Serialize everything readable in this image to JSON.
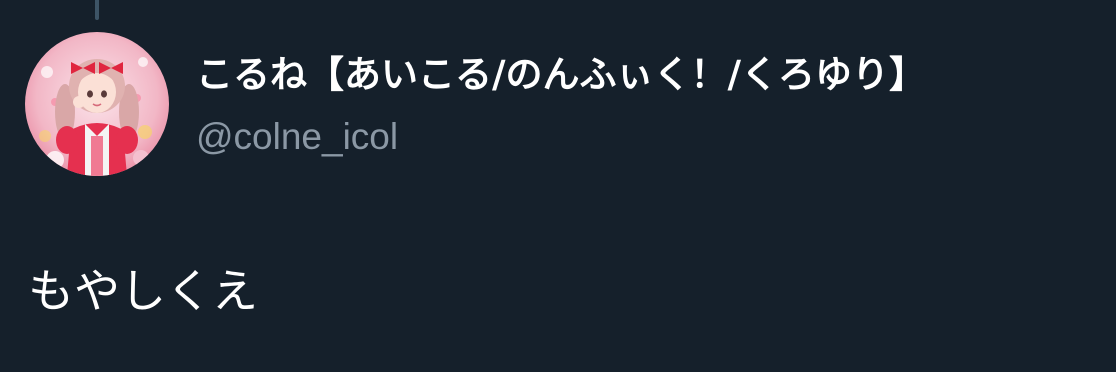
{
  "thread": {
    "connector": "thread-line"
  },
  "author": {
    "avatar_icon": "profile-photo",
    "display_name": "こるね【あいこる/のんふぃく！/くろゆり】",
    "handle": "@colne_icol"
  },
  "tweet": {
    "text": "もやしくえ"
  },
  "colors": {
    "background": "#15202b",
    "text_primary": "#ffffff",
    "text_secondary": "#8b98a5",
    "thread_line": "#3d5466"
  }
}
